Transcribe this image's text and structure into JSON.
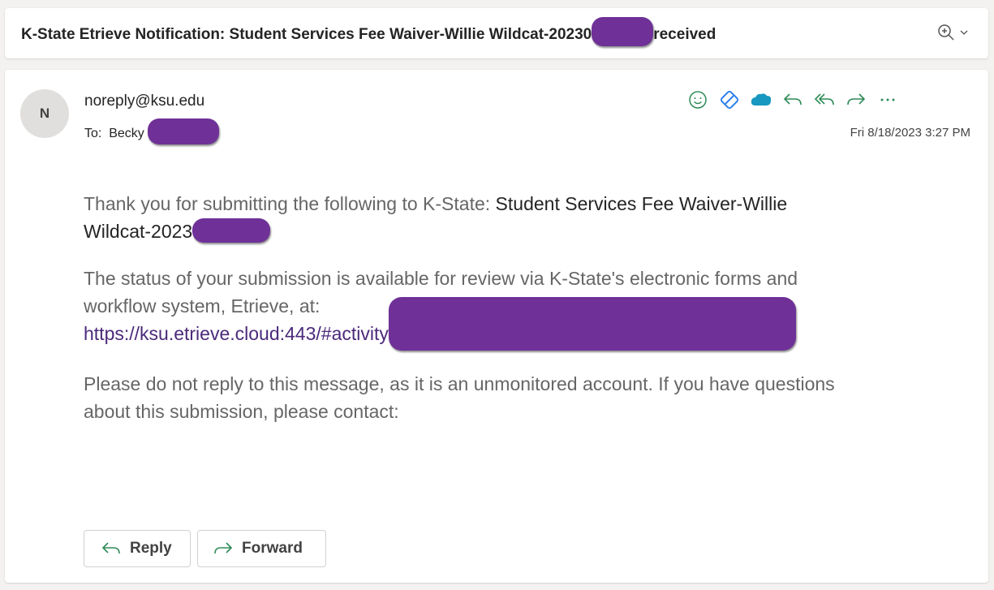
{
  "subject": {
    "prefix": "K-State Etrieve Notification: Student Services Fee Waiver-Willie Wildcat-20230",
    "suffix": "received"
  },
  "header": {
    "avatar_initial": "N",
    "from": "noreply@ksu.edu",
    "to_label": "To:",
    "to_name": "Becky",
    "date": "Fri 8/18/2023 3:27 PM"
  },
  "actions": [
    "emoji-icon",
    "loop-icon",
    "salesforce-icon",
    "reply-icon",
    "reply-all-icon",
    "forward-icon",
    "more-icon"
  ],
  "body": {
    "p1_lead": "Thank you for submitting the following to K-State: ",
    "p1_bold_a": "Student Services Fee Waiver-Willie",
    "p1_bold_b": "Wildcat-2023",
    "p2_a": "The status of your submission is available for review via K-State's electronic forms and",
    "p2_b": "workflow system, Etrieve, at:",
    "link": "https://ksu.etrieve.cloud:443/#activity",
    "p3_a": "Please do not reply to this message, as it is an unmonitored account. If you have questions",
    "p3_b": "about this submission, please contact:"
  },
  "buttons": {
    "reply": "Reply",
    "forward": "Forward"
  },
  "colors": {
    "redaction": "#6f3198",
    "link": "#4b2a7a",
    "icon_green": "#2e8b57",
    "icon_blue": "#2f80ed"
  }
}
